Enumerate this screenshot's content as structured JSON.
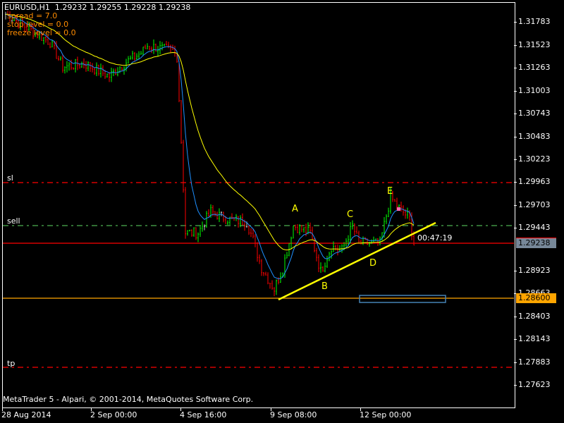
{
  "header": {
    "symbol": "EURUSD,H1",
    "ohlc": "1.29232 1.29255 1.29228 1.29238"
  },
  "info": {
    "spread": "spread = 7.0",
    "stop": "stop level = 0.0",
    "freeze": "freeze level = 0.0"
  },
  "lines": {
    "sl": "sl",
    "sell": "sell",
    "tp": "tp"
  },
  "price_axis": [
    "1.31783",
    "1.31523",
    "1.31263",
    "1.31003",
    "1.30743",
    "1.30483",
    "1.30223",
    "1.29963",
    "1.29703",
    "1.29443",
    "1.28923",
    "1.28663",
    "1.28403",
    "1.28143",
    "1.27883",
    "1.27623"
  ],
  "current_price": "1.29238",
  "level_price": "1.28600",
  "countdown": "00:47:19",
  "time_axis": [
    "28 Aug 2014",
    "2 Sep 00:00",
    "4 Sep 16:00",
    "9 Sep 08:00",
    "12 Sep 00:00"
  ],
  "copyright": "MetaTrader 5 - Alpari, © 2001-2014, MetaQuotes Software Corp.",
  "wave_labels": [
    "A",
    "B",
    "C",
    "D",
    "E"
  ],
  "colors": {
    "bull": "#00ff00",
    "bear": "#ff0000",
    "flat": "#c0c0c0",
    "ema_fast": "#1e90ff",
    "ema_slow": "#ffff00",
    "sl": "#ff0000",
    "sell": "#4caf50",
    "tp": "#ff0000",
    "level": "#ffa500"
  },
  "price_path": [
    [
      0,
      1.31871
    ],
    [
      21,
      1.3155
    ],
    [
      27,
      1.31269
    ],
    [
      37,
      1.31309
    ],
    [
      49,
      1.31164
    ],
    [
      56,
      1.31309
    ],
    [
      64,
      1.31429
    ],
    [
      67,
      1.3151
    ],
    [
      79,
      1.31453
    ],
    [
      81,
      1.31389
    ],
    [
      83,
      1.30425
    ],
    [
      85,
      1.2938
    ],
    [
      91,
      1.2938
    ],
    [
      97,
      1.29621
    ],
    [
      104,
      1.29541
    ],
    [
      114,
      1.29501
    ],
    [
      117,
      1.293
    ],
    [
      121,
      1.28978
    ],
    [
      127,
      1.28737
    ],
    [
      131,
      1.28978
    ],
    [
      136,
      1.2946
    ],
    [
      144,
      1.2938
    ],
    [
      149,
      1.28938
    ],
    [
      154,
      1.29219
    ],
    [
      159,
      1.29179
    ],
    [
      164,
      1.2946
    ],
    [
      167,
      1.29259
    ],
    [
      177,
      1.29259
    ],
    [
      182,
      1.29782
    ],
    [
      186,
      1.29661
    ],
    [
      191,
      1.29541
    ],
    [
      193,
      1.29238
    ]
  ]
}
